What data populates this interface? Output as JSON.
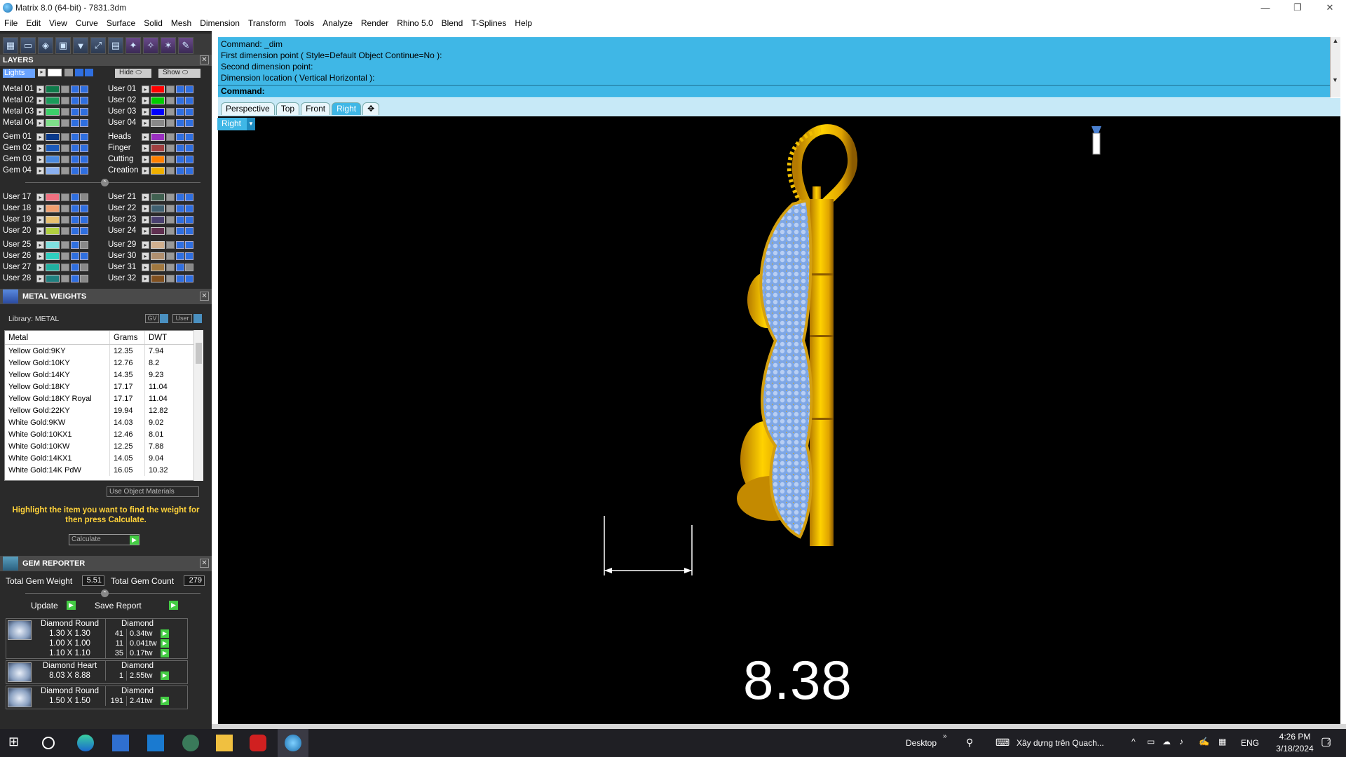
{
  "window": {
    "title": "Matrix 8.0 (64-bit) - 7831.3dm",
    "controls": [
      "—",
      "❐",
      "✕"
    ]
  },
  "menu": [
    "File",
    "Edit",
    "View",
    "Curve",
    "Surface",
    "Solid",
    "Mesh",
    "Dimension",
    "Transform",
    "Tools",
    "Analyze",
    "Render",
    "Rhino 5.0",
    "Blend",
    "T-Splines",
    "Help"
  ],
  "layers": {
    "header": "LAYERS",
    "lights_label": "Lights",
    "hide_label": "Hide",
    "show_label": "Show",
    "left_names": [
      "Metal 01",
      "Metal 02",
      "Metal 03",
      "Metal 04",
      "Gem 01",
      "Gem 02",
      "Gem 03",
      "Gem 04",
      "User 17",
      "User 18",
      "User 19",
      "User 20",
      "User 25",
      "User 26",
      "User 27",
      "User 28"
    ],
    "right_names": [
      "User 01",
      "User 02",
      "User 03",
      "User 04",
      "Heads",
      "Finger",
      "Cutting",
      "Creation",
      "User 21",
      "User 22",
      "User 23",
      "User 24",
      "User 29",
      "User 30",
      "User 31",
      "User 32"
    ],
    "left_colors": [
      "#0f7a4a",
      "#1a9a5a",
      "#3ccf6a",
      "#7fe08a",
      "#0a3a8a",
      "#1a5aba",
      "#4a8ae0",
      "#8ab0f0",
      "#f07080",
      "#f0a070",
      "#e8c070",
      "#b0d040",
      "#80e0e0",
      "#30d0c0",
      "#20b0a0",
      "#208080"
    ],
    "right_colors": [
      "#ff0000",
      "#00cc00",
      "#0000ff",
      "#888888",
      "#9a30c0",
      "#a04040",
      "#ff8000",
      "#f0b000",
      "#406050",
      "#406070",
      "#4a4070",
      "#603050",
      "#d0b090",
      "#b09070",
      "#a07840",
      "#805020"
    ]
  },
  "metal_weights": {
    "header": "METAL WEIGHTS",
    "library": "Library: METAL",
    "gv_label": "GV",
    "user_label": "User",
    "columns": [
      "Metal",
      "Grams",
      "DWT"
    ],
    "rows": [
      [
        "Yellow Gold:9KY",
        "12.35",
        "7.94"
      ],
      [
        "Yellow Gold:10KY",
        "12.76",
        "8.2"
      ],
      [
        "Yellow Gold:14KY",
        "14.35",
        "9.23"
      ],
      [
        "Yellow Gold:18KY",
        "17.17",
        "11.04"
      ],
      [
        "Yellow Gold:18KY Royal",
        "17.17",
        "11.04"
      ],
      [
        "Yellow Gold:22KY",
        "19.94",
        "12.82"
      ],
      [
        "White Gold:9KW",
        "14.03",
        "9.02"
      ],
      [
        "White Gold:10KX1",
        "12.46",
        "8.01"
      ],
      [
        "White Gold:10KW",
        "12.25",
        "7.88"
      ],
      [
        "White Gold:14KX1",
        "14.05",
        "9.04"
      ],
      [
        "White Gold:14K PdW",
        "16.05",
        "10.32"
      ]
    ],
    "use_object_materials": "Use Object Materials",
    "hint": "Highlight the item you want to find the weight for then press Calculate.",
    "calculate": "Calculate"
  },
  "gem_reporter": {
    "header": "GEM REPORTER",
    "total_weight_label": "Total Gem Weight",
    "total_weight": "5.51",
    "total_count_label": "Total Gem Count",
    "total_count": "279",
    "update": "Update",
    "save_report": "Save Report",
    "groups": [
      {
        "shape": "Diamond Round",
        "material": "Diamond",
        "rows": [
          [
            "1.30 X 1.30",
            "41",
            "0.34tw"
          ],
          [
            "1.00 X 1.00",
            "11",
            "0.041tw"
          ],
          [
            "1.10 X 1.10",
            "35",
            "0.17tw"
          ]
        ]
      },
      {
        "shape": "Diamond Heart",
        "material": "Diamond",
        "rows": [
          [
            "8.03 X 8.88",
            "1",
            "2.55tw"
          ]
        ]
      },
      {
        "shape": "Diamond Round",
        "material": "Diamond",
        "rows": [
          [
            "1.50 X 1.50",
            "191",
            "2.41tw"
          ]
        ]
      }
    ]
  },
  "command": {
    "history": [
      "Command: _dim",
      "First dimension point ( Style=Default  Object  Continue=No ):",
      "Second dimension point:",
      "Dimension location ( Vertical  Horizontal ):"
    ],
    "prompt": "Command:"
  },
  "viewport_tabs": [
    "Perspective",
    "Top",
    "Front",
    "Right"
  ],
  "active_tab": "Right",
  "viewport_label": "Right",
  "dimension_value": "8.38",
  "taskbar": {
    "desktop": "Desktop",
    "app_title": "Xây dựng trên Quach...",
    "lang": "ENG",
    "time": "4:26 PM",
    "date": "3/18/2024",
    "notif": "2"
  }
}
